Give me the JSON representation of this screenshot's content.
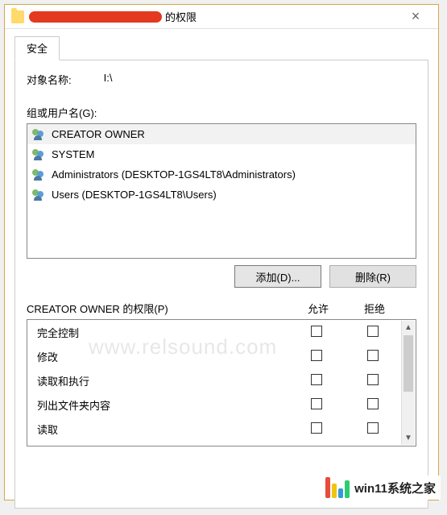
{
  "window": {
    "title_suffix": "的权限",
    "close_label": "×"
  },
  "tabs": [
    {
      "label": "安全"
    }
  ],
  "object": {
    "label": "对象名称:",
    "value": "I:\\"
  },
  "group_section_label": "组或用户名(G):",
  "users": [
    {
      "name": "CREATOR OWNER",
      "selected": true
    },
    {
      "name": "SYSTEM",
      "selected": false
    },
    {
      "name": "Administrators (DESKTOP-1GS4LT8\\Administrators)",
      "selected": false
    },
    {
      "name": "Users (DESKTOP-1GS4LT8\\Users)",
      "selected": false
    }
  ],
  "buttons": {
    "add": "添加(D)...",
    "remove": "删除(R)"
  },
  "perm_header": {
    "title": "CREATOR OWNER 的权限(P)",
    "allow": "允许",
    "deny": "拒绝"
  },
  "permissions": [
    {
      "name": "完全控制",
      "allow": false,
      "deny": false
    },
    {
      "name": "修改",
      "allow": false,
      "deny": false
    },
    {
      "name": "读取和执行",
      "allow": false,
      "deny": false
    },
    {
      "name": "列出文件夹内容",
      "allow": false,
      "deny": false
    },
    {
      "name": "读取",
      "allow": false,
      "deny": false
    }
  ],
  "watermark": "www.relsound.com",
  "brand": "win11系统之家"
}
